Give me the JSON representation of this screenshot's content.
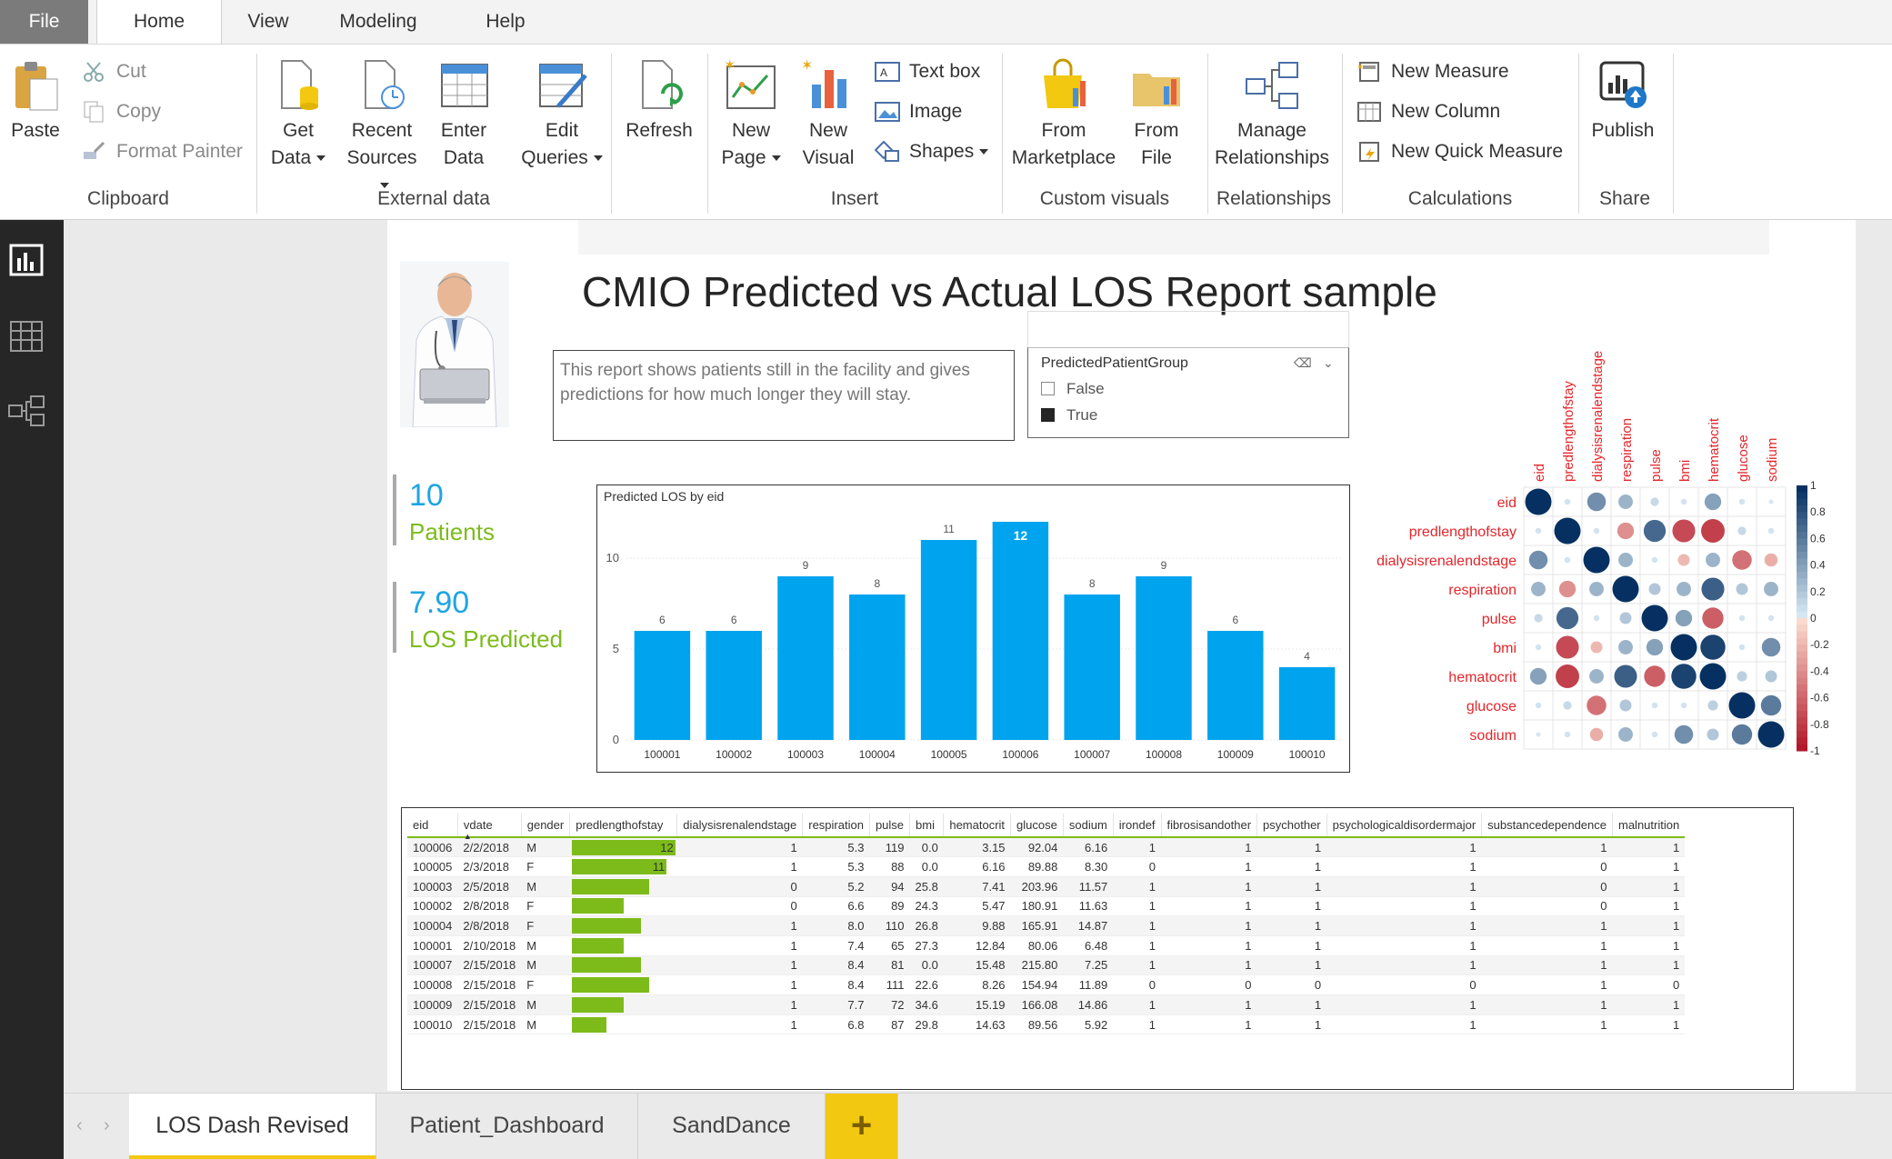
{
  "ribbon_tabs": [
    "File",
    "Home",
    "View",
    "Modeling",
    "Help"
  ],
  "clipboard": {
    "paste": "Paste",
    "cut": "Cut",
    "copy": "Copy",
    "format_painter": "Format Painter",
    "label": "Clipboard"
  },
  "external_data": {
    "get_data_1": "Get",
    "get_data_2": "Data",
    "recent_1": "Recent",
    "recent_2": "Sources",
    "enter_1": "Enter",
    "enter_2": "Data",
    "edit_1": "Edit",
    "edit_2": "Queries",
    "label": "External data"
  },
  "refresh": "Refresh",
  "insert": {
    "new_page_1": "New",
    "new_page_2": "Page",
    "new_visual_1": "New",
    "new_visual_2": "Visual",
    "text_box": "Text box",
    "image": "Image",
    "shapes": "Shapes",
    "label": "Insert"
  },
  "custom_visuals": {
    "marketplace_1": "From",
    "marketplace_2": "Marketplace",
    "file_1": "From",
    "file_2": "File",
    "label": "Custom visuals"
  },
  "relationships": {
    "manage_1": "Manage",
    "manage_2": "Relationships",
    "label": "Relationships"
  },
  "calculations": {
    "new_measure": "New Measure",
    "new_column": "New Column",
    "new_quick_measure": "New Quick Measure",
    "label": "Calculations"
  },
  "share": {
    "publish": "Publish",
    "label": "Share"
  },
  "report": {
    "title": "CMIO Predicted vs Actual LOS Report sample",
    "description": "This report shows patients still in the facility and gives predictions for how much longer they will stay.",
    "slicer": {
      "title": "PredictedPatientGroup",
      "options": [
        "False",
        "True"
      ],
      "selected": "True"
    },
    "kpi_patients": {
      "value": "10",
      "label": "Patients"
    },
    "kpi_los": {
      "value": "7.90",
      "label": "LOS Predicted"
    }
  },
  "chart_data": [
    {
      "type": "bar",
      "title": "Predicted LOS by eid",
      "categories": [
        "100001",
        "100002",
        "100003",
        "100004",
        "100005",
        "100006",
        "100007",
        "100008",
        "100009",
        "100010"
      ],
      "values": [
        6,
        6,
        9,
        8,
        11,
        12,
        8,
        9,
        6,
        4
      ],
      "ylim": [
        0,
        12
      ],
      "yticks": [
        0,
        5,
        10
      ],
      "bar_color": "#00a3ee",
      "highlight_color": "#009ee8"
    },
    {
      "type": "heatmap",
      "variables": [
        "eid",
        "predlengthofstay",
        "dialysisrenalendstage",
        "respiration",
        "pulse",
        "bmi",
        "hematocrit",
        "glucose",
        "sodium"
      ],
      "matrix": [
        [
          1.0,
          0.05,
          0.5,
          0.3,
          0.1,
          0.05,
          0.4,
          0.05,
          0.03
        ],
        [
          0.05,
          1.0,
          0.05,
          -0.4,
          0.7,
          -0.75,
          -0.8,
          0.1,
          0.05
        ],
        [
          0.5,
          0.05,
          1.0,
          0.3,
          0.05,
          -0.2,
          0.3,
          -0.55,
          -0.25
        ],
        [
          0.3,
          -0.4,
          0.3,
          1.0,
          0.2,
          0.3,
          0.75,
          0.2,
          0.3
        ],
        [
          0.1,
          0.7,
          0.05,
          0.2,
          1.0,
          0.4,
          -0.65,
          0.05,
          0.05
        ],
        [
          0.05,
          -0.75,
          -0.2,
          0.3,
          0.4,
          1.0,
          0.9,
          0.05,
          0.5
        ],
        [
          0.4,
          -0.8,
          0.3,
          0.75,
          -0.65,
          0.9,
          1.0,
          0.15,
          0.2
        ],
        [
          0.05,
          0.1,
          -0.55,
          0.2,
          0.05,
          0.05,
          0.15,
          1.0,
          0.6
        ],
        [
          0.03,
          0.05,
          -0.25,
          0.3,
          0.05,
          0.5,
          0.2,
          0.6,
          1.0
        ]
      ],
      "colorbar_ticks": [
        "1",
        "0.8",
        "0.6",
        "0.4",
        "0.2",
        "0",
        "-0.2",
        "-0.4",
        "-0.6",
        "-0.8",
        "-1"
      ]
    }
  ],
  "table": {
    "columns": [
      "eid",
      "vdate",
      "gender",
      "predlengthofstay",
      "dialysisrenalendstage",
      "respiration",
      "pulse",
      "bmi",
      "hematocrit",
      "glucose",
      "sodium",
      "irondef",
      "fibrosisandother",
      "psychother",
      "psychologicaldisordermajor",
      "substancedependence",
      "malnutrition"
    ],
    "rows": [
      [
        "100006",
        "2/2/2018",
        "M",
        "12",
        "1",
        "5.3",
        "119",
        "0.0",
        "3.15",
        "92.04",
        "6.16",
        "1",
        "1",
        "1",
        "1",
        "1",
        "1"
      ],
      [
        "100005",
        "2/3/2018",
        "F",
        "11",
        "1",
        "5.3",
        "88",
        "0.0",
        "6.16",
        "89.88",
        "8.30",
        "0",
        "1",
        "1",
        "1",
        "0",
        "1"
      ],
      [
        "100003",
        "2/5/2018",
        "M",
        "9",
        "0",
        "5.2",
        "94",
        "25.8",
        "7.41",
        "203.96",
        "11.57",
        "1",
        "1",
        "1",
        "1",
        "0",
        "1"
      ],
      [
        "100002",
        "2/8/2018",
        "F",
        "6",
        "0",
        "6.6",
        "89",
        "24.3",
        "5.47",
        "180.91",
        "11.63",
        "1",
        "1",
        "1",
        "1",
        "0",
        "1"
      ],
      [
        "100004",
        "2/8/2018",
        "F",
        "8",
        "1",
        "8.0",
        "110",
        "26.8",
        "9.88",
        "165.91",
        "14.87",
        "1",
        "1",
        "1",
        "1",
        "1",
        "1"
      ],
      [
        "100001",
        "2/10/2018",
        "M",
        "6",
        "1",
        "7.4",
        "65",
        "27.3",
        "12.84",
        "80.06",
        "6.48",
        "1",
        "1",
        "1",
        "1",
        "1",
        "1"
      ],
      [
        "100007",
        "2/15/2018",
        "M",
        "8",
        "1",
        "8.4",
        "81",
        "0.0",
        "15.48",
        "215.80",
        "7.25",
        "1",
        "1",
        "1",
        "1",
        "1",
        "1"
      ],
      [
        "100008",
        "2/15/2018",
        "F",
        "9",
        "1",
        "8.4",
        "111",
        "22.6",
        "8.26",
        "154.94",
        "11.89",
        "0",
        "0",
        "0",
        "0",
        "1",
        "0"
      ],
      [
        "100009",
        "2/15/2018",
        "M",
        "6",
        "1",
        "7.7",
        "72",
        "34.6",
        "15.19",
        "166.08",
        "14.86",
        "1",
        "1",
        "1",
        "1",
        "1",
        "1"
      ],
      [
        "100010",
        "2/15/2018",
        "M",
        "4",
        "1",
        "6.8",
        "87",
        "29.8",
        "14.63",
        "89.56",
        "5.92",
        "1",
        "1",
        "1",
        "1",
        "1",
        "1"
      ]
    ],
    "bar_column_max": 12
  },
  "page_tabs": [
    "LOS Dash Revised",
    "Patient_Dashboard",
    "SandDance"
  ],
  "add_page_label": "+",
  "colors": {
    "accent_yellow": "#f2c811",
    "kpi_blue": "#1ea5e3",
    "kpi_green": "#7dbb1b",
    "bar_blue": "#00a3ee"
  }
}
